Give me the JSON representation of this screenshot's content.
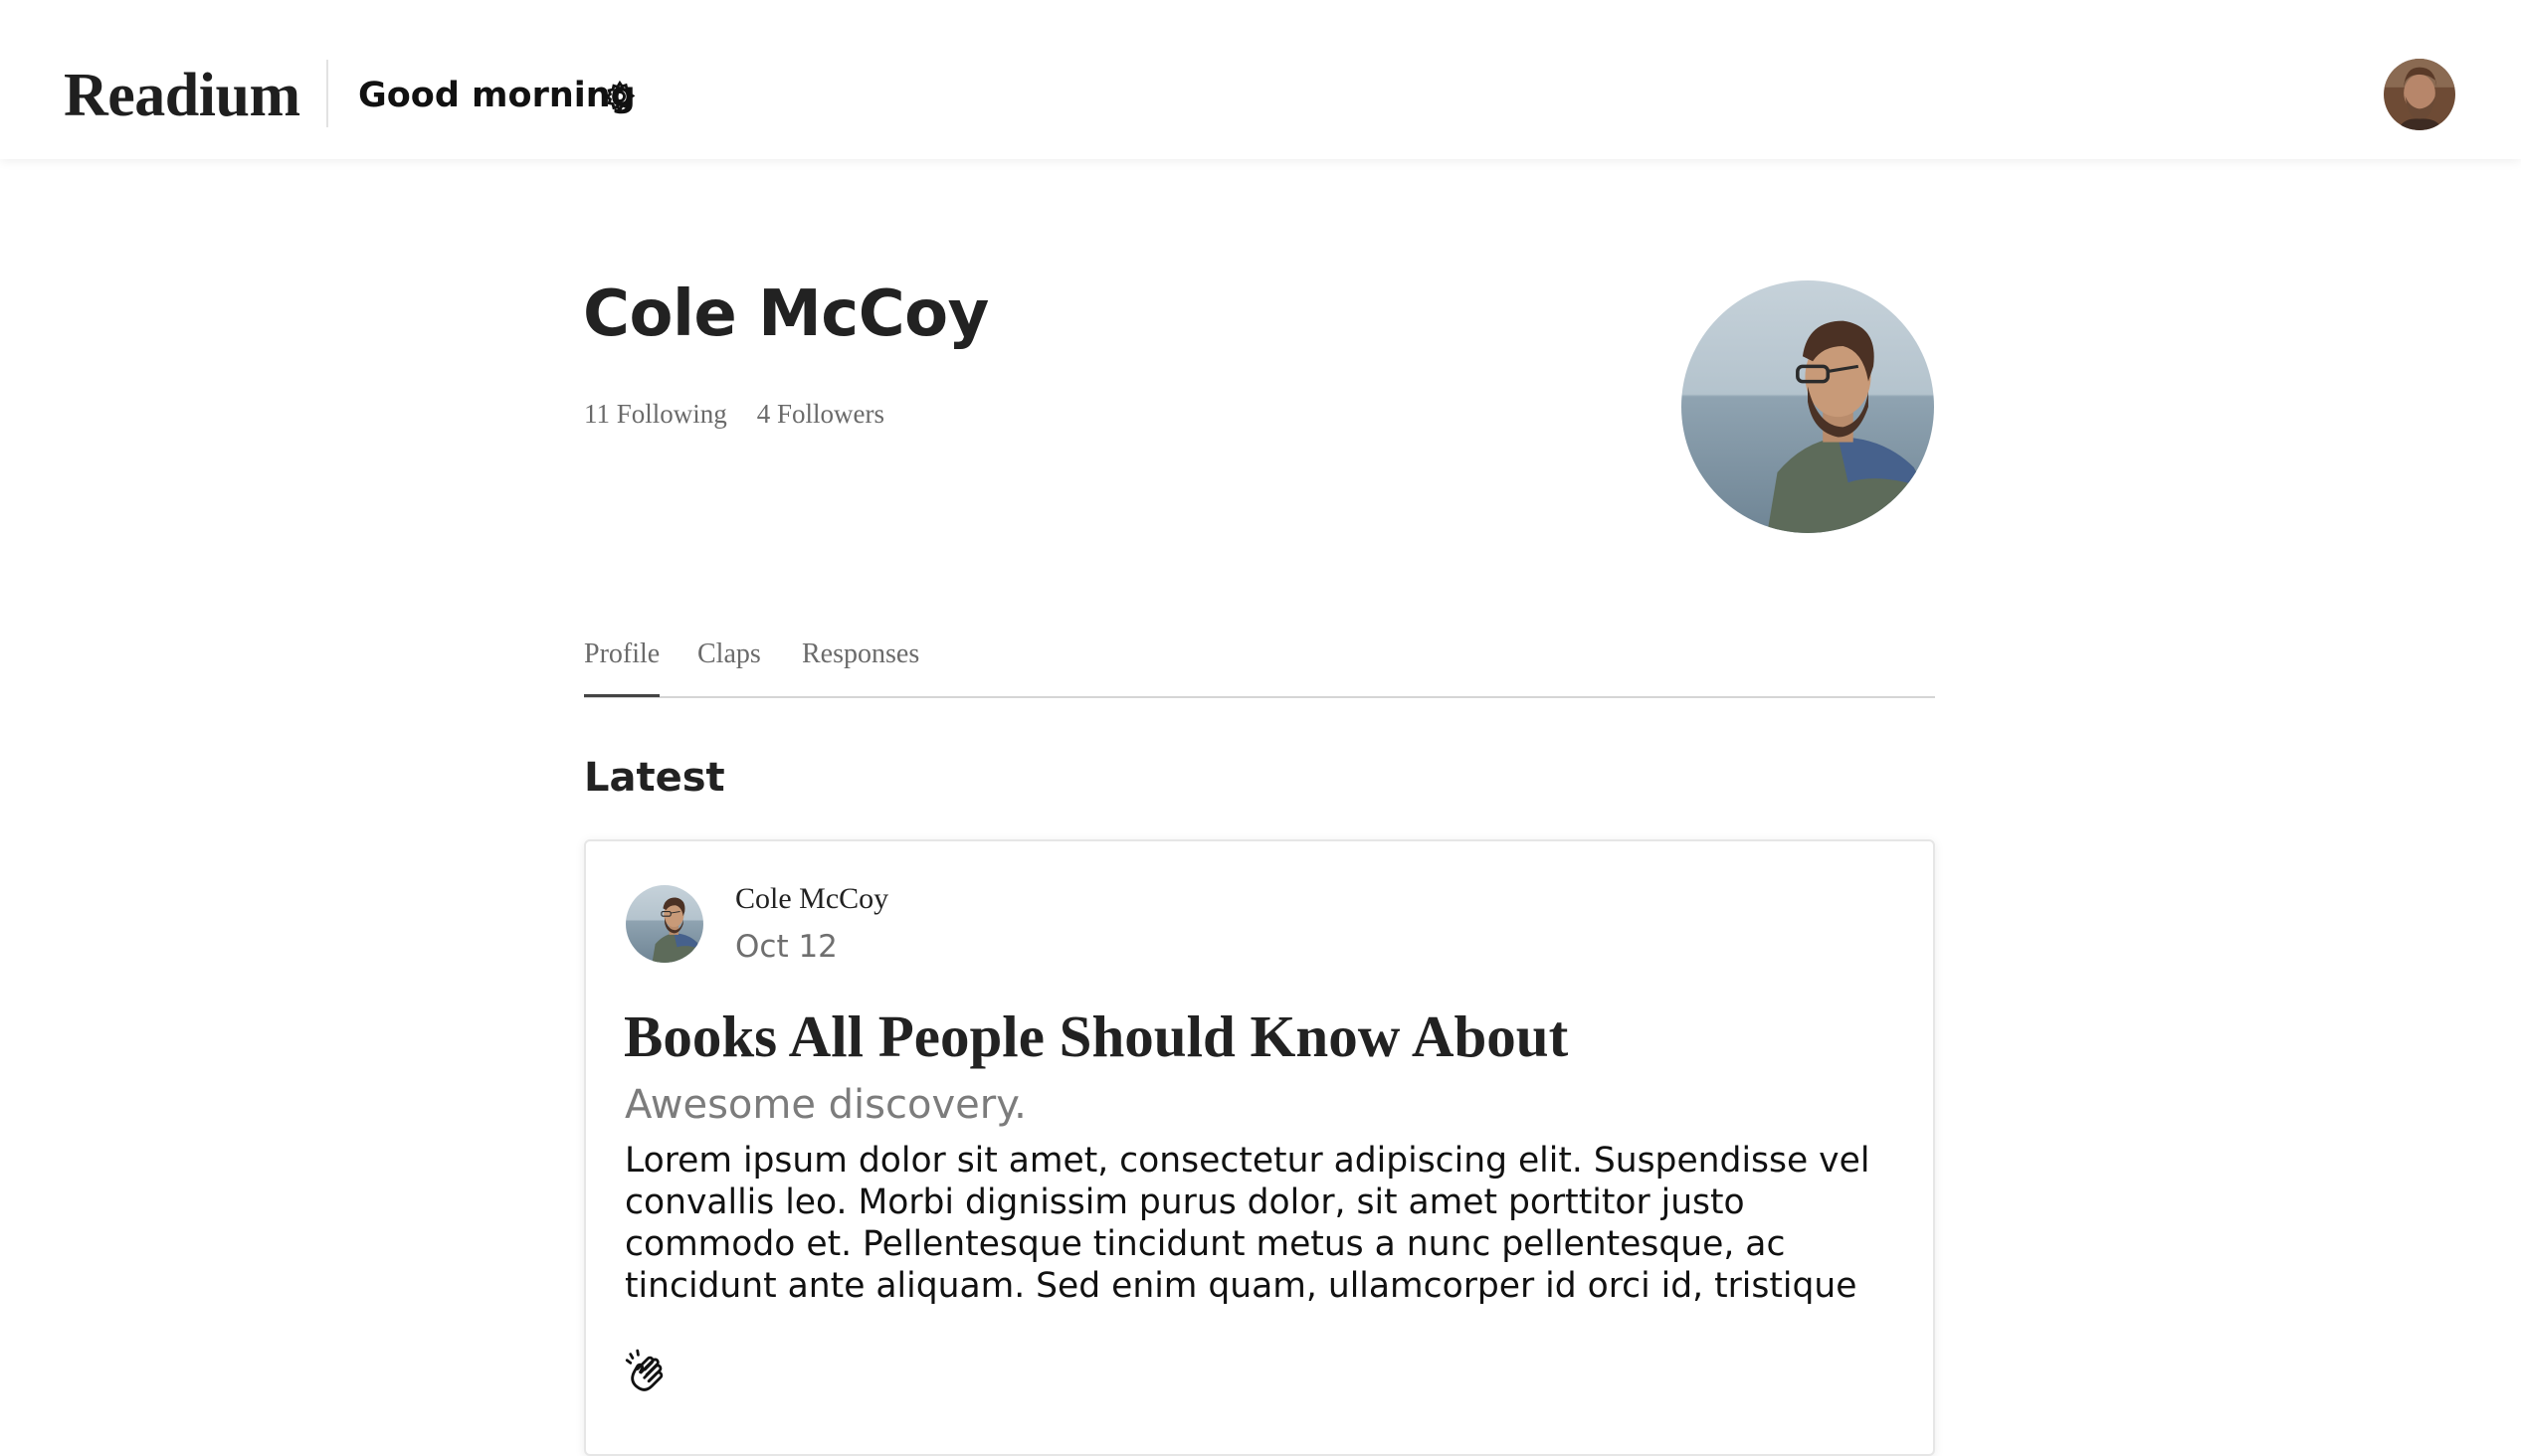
{
  "nav": {
    "brand": "Readium",
    "greeting": "Good morning",
    "settings_icon": "gear-icon",
    "avatar_icon": "user-avatar"
  },
  "profile": {
    "name": "Cole McCoy",
    "following": "11 Following",
    "followers": "4 Followers",
    "avatar_icon": "profile-photo"
  },
  "tabs": [
    {
      "label": "Profile",
      "active": true
    },
    {
      "label": "Claps",
      "active": false
    },
    {
      "label": "Responses",
      "active": false
    }
  ],
  "latest": {
    "heading": "Latest",
    "posts": [
      {
        "author": "Cole McCoy",
        "date": "Oct 12",
        "title": "Books All People Should Know About",
        "subtitle": "Awesome discovery.",
        "excerpt": "Lorem ipsum dolor sit amet, consectetur adipiscing elit. Suspendisse vel convallis leo. Morbi dignissim purus dolor, sit amet porttitor justo commodo et. Pellentesque tincidunt metus a nunc pellentesque, ac tincidunt ante aliquam. Sed enim quam, ullamcorper id orci id, tristique",
        "clap_icon": "clap-icon"
      }
    ]
  },
  "colors": {
    "text": "#222222",
    "muted": "#6b6b6b",
    "divider": "#d5d5d5",
    "background": "#ffffff"
  }
}
